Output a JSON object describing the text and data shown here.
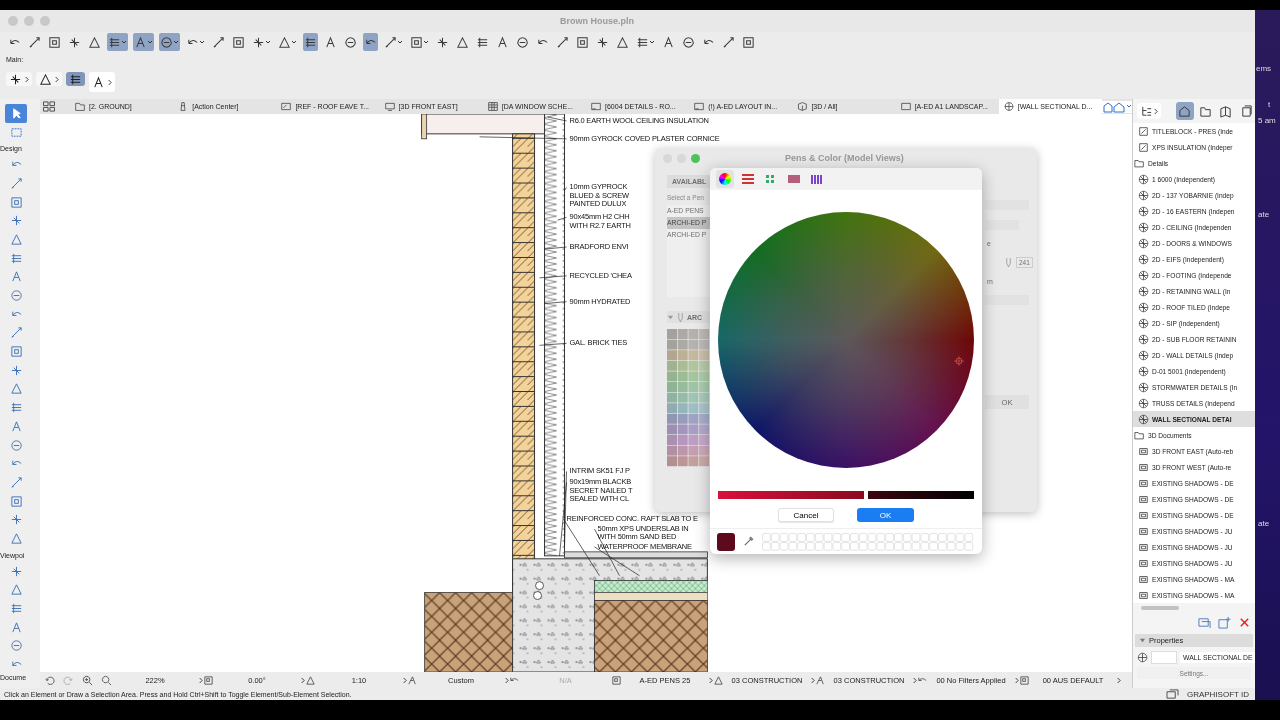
{
  "desktop_fragments": [
    "ems",
    "t",
    "5 am",
    "ate",
    "ate"
  ],
  "window": {
    "title": "Brown House.pln"
  },
  "toolbar": [
    {
      "pressed": false,
      "menu": false
    },
    {
      "pressed": false,
      "menu": false
    },
    {
      "pressed": false,
      "menu": false
    },
    {
      "pressed": false,
      "menu": false
    },
    {
      "pressed": false,
      "menu": false
    },
    {
      "pressed": true,
      "menu": true
    },
    {
      "pressed": true,
      "menu": true
    },
    {
      "pressed": true,
      "menu": true
    },
    {
      "pressed": false,
      "menu": true
    },
    {
      "pressed": false,
      "menu": false
    },
    {
      "pressed": false,
      "menu": false
    },
    {
      "pressed": false,
      "menu": true
    },
    {
      "pressed": false,
      "menu": true
    },
    {
      "pressed": true,
      "menu": false
    },
    {
      "pressed": false,
      "menu": false
    },
    {
      "pressed": false,
      "menu": false
    },
    {
      "pressed": true,
      "menu": false
    },
    {
      "pressed": false,
      "menu": true
    },
    {
      "pressed": false,
      "menu": true
    },
    {
      "pressed": false,
      "menu": false
    },
    {
      "pressed": false,
      "menu": false
    },
    {
      "pressed": false,
      "menu": false
    },
    {
      "pressed": false,
      "menu": false
    },
    {
      "pressed": false,
      "menu": false
    },
    {
      "pressed": false,
      "menu": false
    },
    {
      "pressed": false,
      "menu": false
    },
    {
      "pressed": false,
      "menu": false
    },
    {
      "pressed": false,
      "menu": false
    },
    {
      "pressed": false,
      "menu": false
    },
    {
      "pressed": false,
      "menu": true
    },
    {
      "pressed": false,
      "menu": false
    },
    {
      "pressed": false,
      "menu": false
    },
    {
      "pressed": false,
      "menu": false
    },
    {
      "pressed": false,
      "menu": false
    },
    {
      "pressed": false,
      "menu": false
    }
  ],
  "main_toolbar": {
    "label": "Main:",
    "buttons": [
      {
        "selected": false,
        "menu": true
      },
      {
        "selected": false,
        "menu": true
      },
      {
        "selected": true,
        "menu": false
      },
      {
        "selected": false,
        "menu": true
      }
    ]
  },
  "toolbox": {
    "top_tools": [
      {
        "selected": true
      },
      {
        "selected": false
      }
    ],
    "sections": [
      {
        "label": "Design",
        "tools": [
          {
            "selected": false
          },
          {
            "selected": false
          },
          {
            "selected": false
          },
          {
            "selected": false
          },
          {
            "selected": false
          },
          {
            "selected": false
          },
          {
            "selected": false
          },
          {
            "selected": false
          },
          {
            "selected": false
          },
          {
            "selected": false
          },
          {
            "selected": false
          },
          {
            "selected": false
          },
          {
            "selected": false
          },
          {
            "selected": false
          },
          {
            "selected": false
          },
          {
            "selected": false
          },
          {
            "selected": false
          },
          {
            "selected": false
          },
          {
            "selected": false
          },
          {
            "selected": false
          },
          {
            "selected": false
          }
        ]
      },
      {
        "label": "Viewpoi",
        "tools": [
          {
            "selected": false
          },
          {
            "selected": false
          },
          {
            "selected": false
          },
          {
            "selected": false
          },
          {
            "selected": false
          },
          {
            "selected": false
          }
        ]
      }
    ],
    "bottom_label": "Docume"
  },
  "tabs": [
    {
      "label": "[2. GROUND]",
      "kind": "plan",
      "selected": false
    },
    {
      "label": "[Action Center]",
      "kind": "action",
      "selected": false
    },
    {
      "label": "[REF - ROOF EAVE T...",
      "kind": "section",
      "selected": false
    },
    {
      "label": "[3D FRONT EAST]",
      "kind": "document",
      "selected": false
    },
    {
      "label": "[DA WINDOW SCHE...",
      "kind": "schedule",
      "selected": false
    },
    {
      "label": "[6004 DETAILS - RO...",
      "kind": "layout",
      "selected": false
    },
    {
      "label": "(!) A-ED LAYOUT IN...",
      "kind": "layout",
      "selected": false
    },
    {
      "label": "[3D / All]",
      "kind": "model",
      "selected": false
    },
    {
      "label": "[A-ED A1 LANDSCAP...",
      "kind": "sheet",
      "selected": false
    },
    {
      "label": "[WALL SECTIONAL D...",
      "kind": "detail",
      "selected": true
    }
  ],
  "drawing": {
    "annotations": [
      {
        "lines": [
          "R6.0 EARTH WOOL CEILING INSULATION"
        ]
      },
      {
        "lines": [
          "90mm GYROCK COVED PLASTER CORNICE"
        ]
      },
      {
        "lines": [
          "10mm GYPROCK",
          "BLUED & SCREW",
          "PAINTED DULUX"
        ]
      },
      {
        "lines": [
          "90x45mm H2 CHH",
          "WITH R2.7 EARTH"
        ]
      },
      {
        "lines": [
          "BRADFORD ENVI"
        ]
      },
      {
        "lines": [
          "RECYCLED 'CHEA"
        ]
      },
      {
        "lines": [
          "90mm HYDRATED"
        ]
      },
      {
        "lines": [
          "GAL. BRICK TIES"
        ]
      },
      {
        "lines": [
          "INTRIM SK51 FJ P"
        ]
      },
      {
        "lines": [
          "90x19mm BLACKB",
          "SECRET NAILED T",
          "SEALED WITH CL"
        ]
      },
      {
        "lines": [
          "REINFORCED CONC. RAFT SLAB TO E"
        ]
      },
      {
        "lines": [
          "50mm XPS UNDERSLAB IN",
          "WITH 50mm SAND BED"
        ]
      },
      {
        "lines": [
          "WATERPROOF MEMBRANE"
        ]
      }
    ]
  },
  "pens_dialog": {
    "title": "Pens & Color (Model Views)",
    "tab": "AVAILABL",
    "prompt": "Select a Pen",
    "pen_sets": [
      {
        "label": "A-ED PENS",
        "selected": false
      },
      {
        "label": "ARCHI-ED P",
        "selected": true
      },
      {
        "label": "ARCHI-ED P",
        "selected": false
      }
    ],
    "group_label": "ARC",
    "fragments": [
      "e",
      "m"
    ],
    "pen_number": "241",
    "ok": "OK"
  },
  "color_picker": {
    "modes": [
      {
        "selected": true
      },
      {
        "selected": false
      },
      {
        "selected": false
      },
      {
        "selected": false
      },
      {
        "selected": false
      }
    ],
    "brightness": {
      "level": 0.58
    },
    "cancel": "Cancel",
    "ok": "OK",
    "swatch": {
      "color": "#5c0a1c"
    }
  },
  "navigator": {
    "items": [
      {
        "label": "TITLEBLOCK - PRES (Inde",
        "kind": "worksheet",
        "selected": false
      },
      {
        "label": "XPS INSULATION (Indeper",
        "kind": "worksheet",
        "selected": false
      },
      {
        "label": "Details",
        "kind": "folder",
        "selected": false
      },
      {
        "label": "1 6000 (Independent)",
        "kind": "detail",
        "selected": false
      },
      {
        "label": "2D - 137 YOBARNIE (Indep",
        "kind": "detail",
        "selected": false
      },
      {
        "label": "2D - 16 EASTERN (Indepen",
        "kind": "detail",
        "selected": false
      },
      {
        "label": "2D - CEILING (Independen",
        "kind": "detail",
        "selected": false
      },
      {
        "label": "2D - DOORS & WINDOWS",
        "kind": "detail",
        "selected": false
      },
      {
        "label": "2D - EIFS (Independent)",
        "kind": "detail",
        "selected": false
      },
      {
        "label": "2D - FOOTING (Independe",
        "kind": "detail",
        "selected": false
      },
      {
        "label": "2D - RETAINING WALL (In",
        "kind": "detail",
        "selected": false
      },
      {
        "label": "2D - ROOF TILED (Indepe",
        "kind": "detail",
        "selected": false
      },
      {
        "label": "2D - SIP (Independent)",
        "kind": "detail",
        "selected": false
      },
      {
        "label": "2D - SUB FLOOR RETAININ",
        "kind": "detail",
        "selected": false
      },
      {
        "label": "2D - WALL DETAILS (Indep",
        "kind": "detail",
        "selected": false
      },
      {
        "label": "D-01 5001 (Independent)",
        "kind": "detail",
        "selected": false
      },
      {
        "label": "STORMWATER DETAILS (In",
        "kind": "detail",
        "selected": false
      },
      {
        "label": "TRUSS DETAILS (Independ",
        "kind": "detail",
        "selected": false
      },
      {
        "label": "WALL SECTIONAL DETAI",
        "kind": "detail",
        "selected": true
      },
      {
        "label": "3D Documents",
        "kind": "folder",
        "selected": false
      },
      {
        "label": "3D FRONT EAST (Auto-reb",
        "kind": "document",
        "selected": false
      },
      {
        "label": "3D FRONT WEST (Auto-re",
        "kind": "document",
        "selected": false
      },
      {
        "label": "EXISTING SHADOWS - DE",
        "kind": "document",
        "selected": false
      },
      {
        "label": "EXISTING SHADOWS - DE",
        "kind": "document",
        "selected": false
      },
      {
        "label": "EXISTING SHADOWS - DE",
        "kind": "document",
        "selected": false
      },
      {
        "label": "EXISTING SHADOWS - JU",
        "kind": "document",
        "selected": false
      },
      {
        "label": "EXISTING SHADOWS - JU",
        "kind": "document",
        "selected": false
      },
      {
        "label": "EXISTING SHADOWS - JU",
        "kind": "document",
        "selected": false
      },
      {
        "label": "EXISTING SHADOWS - MA",
        "kind": "document",
        "selected": false
      },
      {
        "label": "EXISTING SHADOWS - MA",
        "kind": "document",
        "selected": false
      }
    ],
    "properties": {
      "title": "Properties",
      "name": "WALL SECTIONAL DE",
      "settings": "Settings..."
    }
  },
  "bottom_bar": [
    {
      "label": "222%",
      "disabled": false
    },
    {
      "label": "0.00°",
      "disabled": false
    },
    {
      "label": "1:10",
      "disabled": false
    },
    {
      "label": "Custom",
      "disabled": false
    },
    {
      "label": "N/A",
      "disabled": true
    },
    {
      "label": "A-ED PENS 25",
      "disabled": false
    },
    {
      "label": "03 CONSTRUCTION",
      "disabled": false
    },
    {
      "label": "03 CONSTRUCTION",
      "disabled": false
    },
    {
      "label": "00 No Filters Applied",
      "disabled": false
    },
    {
      "label": "00 AUS DEFAULT",
      "disabled": false
    }
  ],
  "status": {
    "message": "Click an Element or Draw a Selection Area. Press and Hold Ctrl+Shift to Toggle Element/Sub-Element Selection.",
    "account": "GRAPHISOFT ID"
  }
}
